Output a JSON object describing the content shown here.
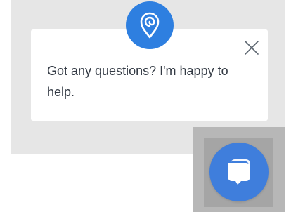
{
  "popup": {
    "message": "Got any questions? I'm happy to help.",
    "close_icon": "close-icon",
    "badge_icon": "location-pin-swirl-icon"
  },
  "launcher": {
    "icon": "chat-bubbles-icon"
  },
  "colors": {
    "accent": "#2e7fe0",
    "launcher": "#3f7edc",
    "backdrop": "#e6e6e6",
    "card": "#ffffff",
    "text": "#333a44"
  }
}
